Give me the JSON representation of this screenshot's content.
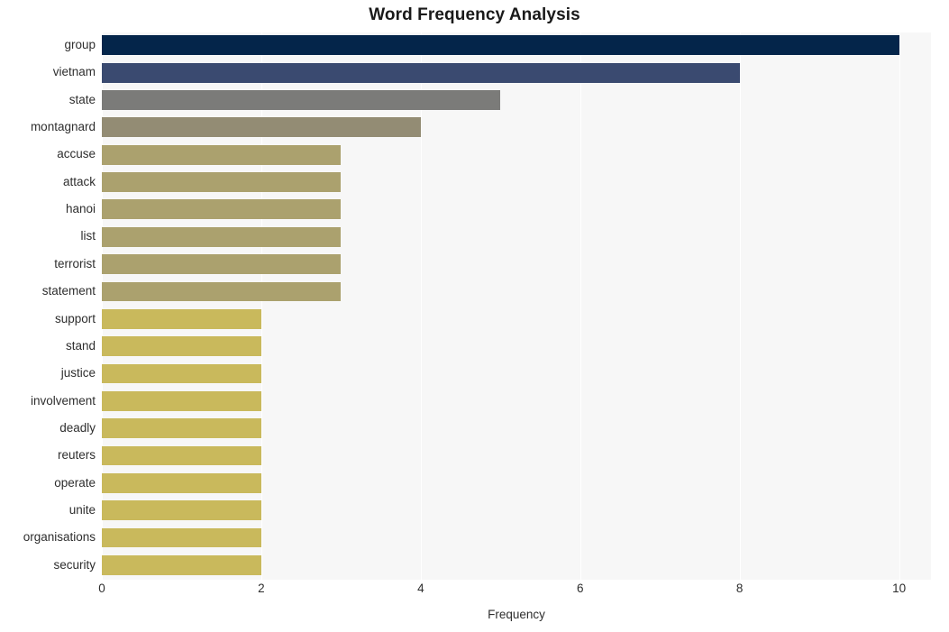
{
  "chart_data": {
    "type": "bar",
    "orientation": "horizontal",
    "title": "Word Frequency Analysis",
    "xlabel": "Frequency",
    "ylabel": "",
    "xlim": [
      0,
      10.4
    ],
    "grid": true,
    "legend": false,
    "xticks": [
      "0",
      "2",
      "4",
      "6",
      "8",
      "10"
    ],
    "xtick_values": [
      0,
      2,
      4,
      6,
      8,
      10
    ],
    "categories": [
      "group",
      "vietnam",
      "state",
      "montagnard",
      "accuse",
      "attack",
      "hanoi",
      "list",
      "terrorist",
      "statement",
      "support",
      "stand",
      "justice",
      "involvement",
      "deadly",
      "reuters",
      "operate",
      "unite",
      "organisations",
      "security"
    ],
    "values": [
      10,
      8,
      5,
      4,
      3,
      3,
      3,
      3,
      3,
      3,
      2,
      2,
      2,
      2,
      2,
      2,
      2,
      2,
      2,
      2
    ],
    "bar_colors": [
      "#04254a",
      "#3a4a70",
      "#7b7b79",
      "#938c74",
      "#aba16e",
      "#aba16e",
      "#aba16e",
      "#aba16e",
      "#aba16e",
      "#aba16e",
      "#c9b95c",
      "#c9b95c",
      "#c9b95c",
      "#c9b95c",
      "#c9b95c",
      "#c9b95c",
      "#c9b95c",
      "#c9b95c",
      "#c9b95c",
      "#c9b95c"
    ]
  },
  "style": {
    "plot_background": "#f7f7f7",
    "figure_background": "#ffffff",
    "gridline_color": "#ffffff",
    "tick_label_color": "#2e2e2e",
    "title_color": "#1a1a1a"
  }
}
